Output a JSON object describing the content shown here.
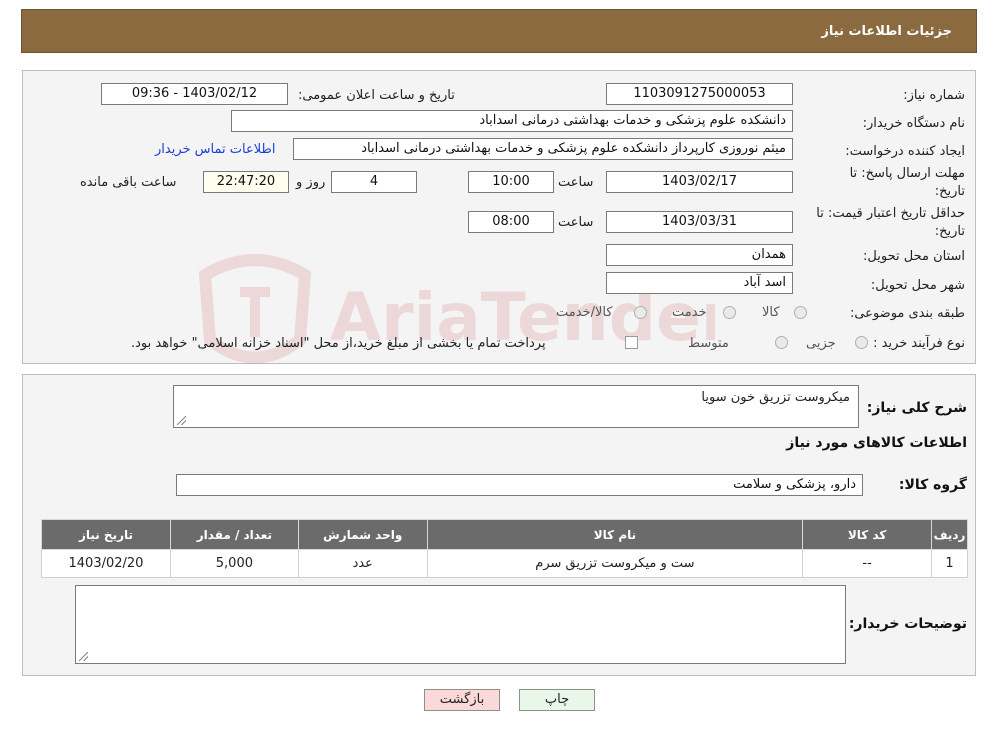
{
  "header": {
    "title": "جزئیات اطلاعات نیاز"
  },
  "fields": {
    "need_number": {
      "label": "شماره نیاز:",
      "value": "1103091275000053"
    },
    "announce_datetime": {
      "label": "تاریخ و ساعت اعلان عمومی:",
      "value": "1403/02/12 - 09:36"
    },
    "buyer_org": {
      "label": "نام دستگاه خریدار:",
      "value": "دانشکده علوم پزشکی و خدمات بهداشتی درمانی اسداباد"
    },
    "requester": {
      "label": "ایجاد کننده درخواست:",
      "value": "میثم نوروزی کارپرداز دانشکده علوم پزشکی و خدمات بهداشتی درمانی اسداباد"
    },
    "contact_link": "اطلاعات تماس خریدار",
    "reply_deadline": {
      "label_line1": "مهلت ارسال پاسخ: تا",
      "label_line2": "تاریخ:",
      "date": "1403/02/17",
      "time_label": "ساعت",
      "time": "10:00",
      "days": "4",
      "days_label": "روز و",
      "remaining": "22:47:20",
      "remaining_label": "ساعت باقی مانده"
    },
    "price_validity": {
      "label_line1": "حداقل تاریخ اعتبار قیمت: تا",
      "label_line2": "تاریخ:",
      "date": "1403/03/31",
      "time_label": "ساعت",
      "time": "08:00"
    },
    "delivery_province": {
      "label": "استان محل تحویل:",
      "value": "همدان"
    },
    "delivery_city": {
      "label": "شهر محل تحویل:",
      "value": "اسد آباد"
    },
    "category": {
      "label": "طبقه بندی موضوعی:",
      "options": [
        "کالا",
        "خدمت",
        "کالا/خدمت"
      ]
    },
    "purchase_process": {
      "label": "نوع فرآیند خرید :",
      "options": [
        "جزیی",
        "متوسط"
      ],
      "note": "پرداخت تمام یا بخشی از مبلغ خرید،از محل \"اسناد خزانه اسلامی\" خواهد بود."
    }
  },
  "summary": {
    "label": "شرح کلی نیاز:",
    "value": "میکروست تزریق خون سویا"
  },
  "goods_info_title": "اطلاعات کالاهای مورد نیاز",
  "goods_group": {
    "label": "گروه کالا:",
    "value": "دارو، پزشکی و سلامت"
  },
  "table": {
    "headers": [
      "ردیف",
      "کد کالا",
      "نام کالا",
      "واحد شمارش",
      "تعداد / مقدار",
      "تاریخ نیاز"
    ],
    "rows": [
      [
        "1",
        "--",
        "ست و میکروست تزریق سرم",
        "عدد",
        "5,000",
        "1403/02/20"
      ]
    ]
  },
  "buyer_notes": {
    "label": "توضیحات خریدار:",
    "value": ""
  },
  "buttons": {
    "back": "بازگشت",
    "print": "چاپ"
  },
  "watermark_text": "AriaTender.neT",
  "colors": {
    "header": "#8c6a3f",
    "table_header": "#6b6b6b",
    "link": "#1a3fd6",
    "back_button": "#fbd9d9",
    "print_button": "#e9f7e9"
  }
}
